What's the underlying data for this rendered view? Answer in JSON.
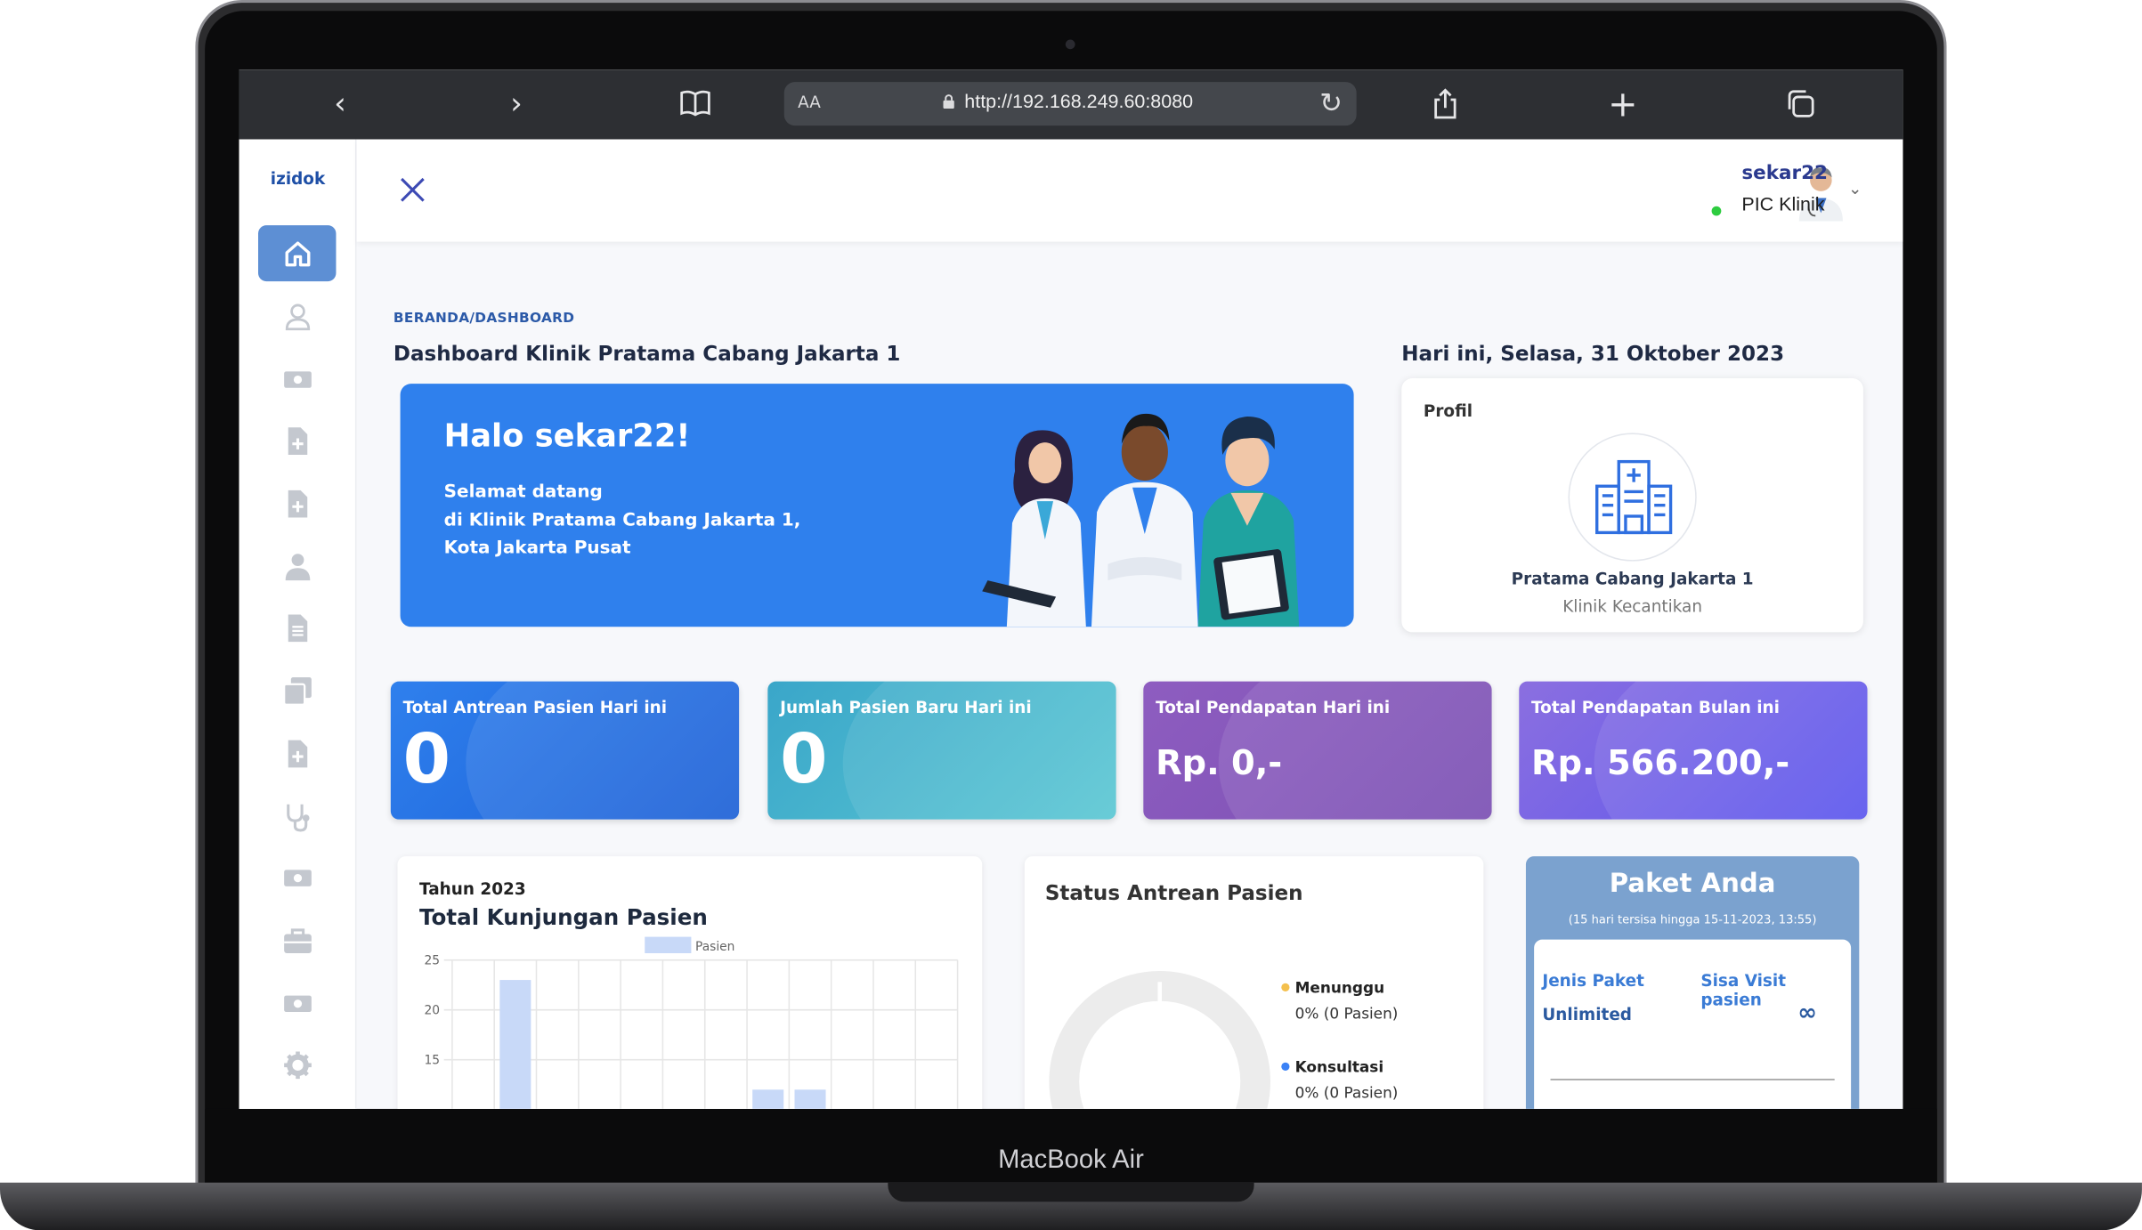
{
  "device": {
    "label": "MacBook Air"
  },
  "browser": {
    "aa_label": "AA",
    "url": "http://192.168.249.60:8080"
  },
  "sidebar": {
    "logo": "izidok",
    "items": [
      "home-icon",
      "user-icon",
      "money-icon",
      "file-plus-icon",
      "file-plus-icon",
      "person-icon",
      "document-icon",
      "copy-icon",
      "file-plus-icon",
      "stethoscope-icon",
      "money-icon",
      "briefcase-icon",
      "money-icon",
      "gear-icon"
    ]
  },
  "user": {
    "name": "sekar22",
    "role": "PIC Klinik"
  },
  "page": {
    "breadcrumb": "BERANDA/DASHBOARD",
    "title": "Dashboard Klinik Pratama Cabang Jakarta 1",
    "today": "Hari ini, Selasa, 31 Oktober 2023"
  },
  "banner": {
    "greeting": "Halo sekar22!",
    "welcome_line1": "Selamat datang",
    "welcome_line2": "di Klinik Pratama Cabang Jakarta 1,",
    "welcome_line3": "Kota Jakarta Pusat"
  },
  "profile": {
    "heading": "Profil",
    "clinic_name": "Pratama Cabang Jakarta 1",
    "clinic_type": "Klinik Kecantikan"
  },
  "stats": [
    {
      "label": "Total Antrean Pasien Hari ini",
      "value": "0",
      "color_start": "#2f80ed",
      "color_end": "#1b5fd6"
    },
    {
      "label": "Jumlah Pasien Baru Hari ini",
      "value": "0",
      "color_start": "#3aa6c9",
      "color_end": "#5ac7d3"
    },
    {
      "label": "Total Pendapatan Hari ini",
      "value": "Rp. 0,-",
      "color_start": "#8e5dc0",
      "color_end": "#7a4fb3"
    },
    {
      "label": "Total Pendapatan Bulan ini",
      "value": "Rp. 566.200,-",
      "color_start": "#8b6fe0",
      "color_end": "#5a55ee"
    }
  ],
  "visits": {
    "year_label": "Tahun 2023",
    "title": "Total Kunjungan Pasien"
  },
  "chart_data": {
    "type": "bar",
    "legend": [
      "Pasien"
    ],
    "series": [
      {
        "name": "Pasien",
        "values": [
          0,
          23,
          0,
          0,
          0,
          0,
          0,
          12,
          12,
          0,
          0,
          0
        ]
      }
    ],
    "y_ticks": [
      25,
      20,
      15
    ],
    "ylim": [
      10,
      25
    ],
    "grid": true,
    "color": "#c8d9f8",
    "legend_position": "top"
  },
  "queue_status": {
    "title": "Status Antrean Pasien",
    "legend": [
      {
        "name": "Menunggu",
        "value": "0% (0 Pasien)",
        "color": "#f4c04e"
      },
      {
        "name": "Konsultasi",
        "value": "0% (0 Pasien)",
        "color": "#3b82f6"
      }
    ]
  },
  "package": {
    "title": "Paket Anda",
    "subtitle": "(15 hari tersisa hingga 15-11-2023, 13:55)",
    "col1_header": "Jenis Paket",
    "col2_header": "Sisa Visit pasien",
    "col1_value": "Unlimited",
    "col2_value": "∞"
  }
}
